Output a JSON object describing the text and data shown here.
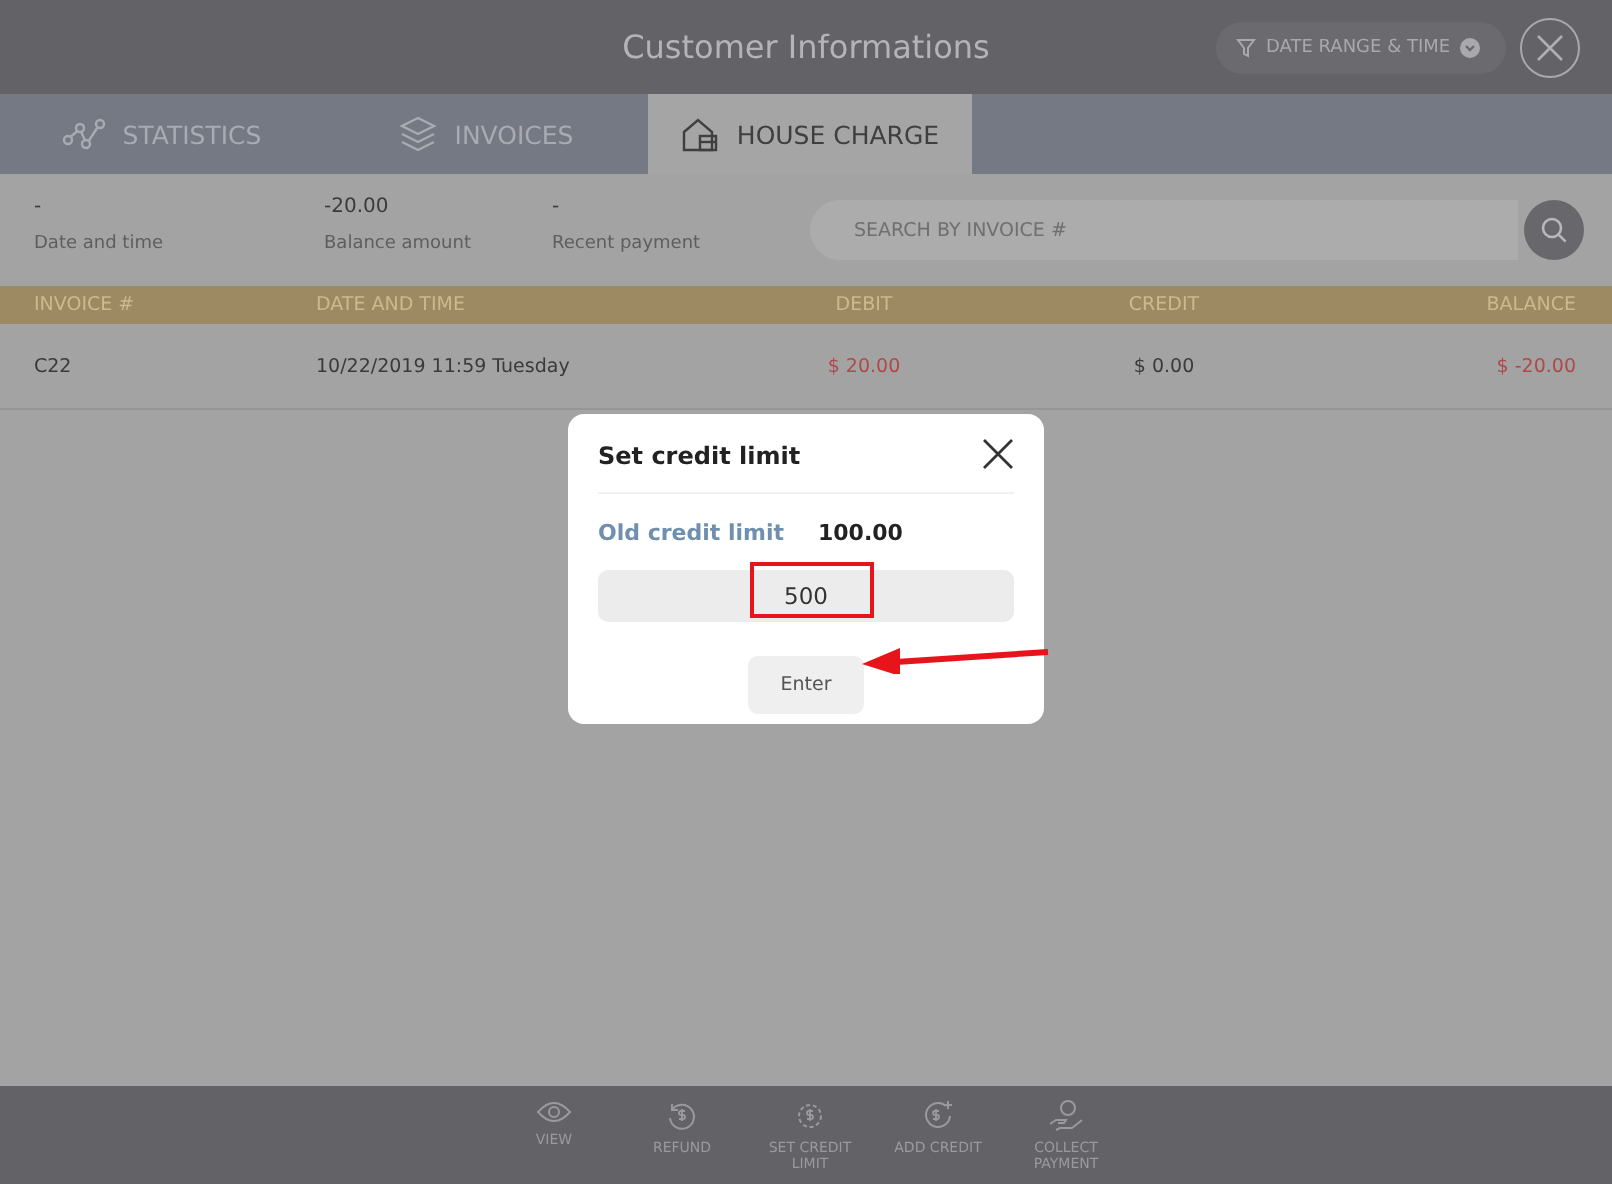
{
  "header": {
    "title": "Customer Informations",
    "filter_button": "DATE RANGE & TIME"
  },
  "tabs": [
    {
      "label": "STATISTICS",
      "kind": "statistics",
      "selected": false
    },
    {
      "label": "INVOICES",
      "kind": "invoices",
      "selected": false
    },
    {
      "label": "HOUSE CHARGE",
      "kind": "house",
      "selected": true
    }
  ],
  "summary": [
    {
      "value": "-",
      "label": "Date and time"
    },
    {
      "value": "-20.00",
      "label": "Balance amount"
    },
    {
      "value": "-",
      "label": "Recent payment"
    }
  ],
  "search": {
    "placeholder": "SEARCH BY INVOICE #"
  },
  "table": {
    "columns": [
      "INVOICE #",
      "DATE AND TIME",
      "DEBIT",
      "CREDIT",
      "BALANCE"
    ],
    "rows": [
      {
        "cells": [
          {
            "text": "C22",
            "negative": false
          },
          {
            "text": "10/22/2019 11:59 Tuesday",
            "negative": false
          },
          {
            "text": "$ 20.00",
            "negative": true
          },
          {
            "text": "$ 0.00",
            "negative": false
          },
          {
            "text": "$ -20.00",
            "negative": true
          }
        ]
      }
    ]
  },
  "dialog": {
    "title": "Set credit limit",
    "old_limit_label": "Old credit limit",
    "old_limit_value": "100.00",
    "input_value": "500",
    "button": "Enter"
  },
  "toolbar": [
    {
      "label": "VIEW",
      "kind": "view"
    },
    {
      "label": "REFUND",
      "kind": "refund"
    },
    {
      "label": "SET CREDIT LIMIT",
      "kind": "gear"
    },
    {
      "label": "ADD CREDIT",
      "kind": "add"
    },
    {
      "label": "COLLECT PAYMENT",
      "kind": "collect"
    }
  ]
}
